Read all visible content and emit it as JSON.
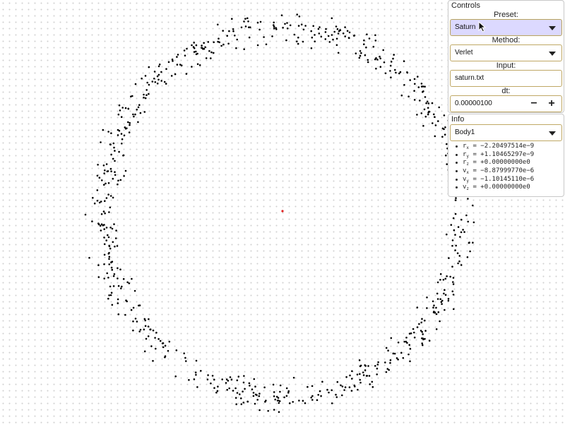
{
  "controls": {
    "title": "Controls",
    "preset_label": "Preset:",
    "preset_value": "Saturn",
    "method_label": "Method:",
    "method_value": "Verlet",
    "input_label": "Input:",
    "input_value": "saturn.txt",
    "dt_label": "dt:",
    "dt_value": "0.00000100",
    "dt_minus": "−",
    "dt_plus": "+"
  },
  "info": {
    "title": "Info",
    "body_value": "Body1",
    "lines": [
      {
        "name": "r",
        "sub": "x",
        "value": " = −2.20497514e−9"
      },
      {
        "name": "r",
        "sub": "y",
        "value": " = +1.10465297e−9"
      },
      {
        "name": "r",
        "sub": "z",
        "value": " = +0.00000000e0"
      },
      {
        "name": "v",
        "sub": "x",
        "value": " = −8.87999770e−6"
      },
      {
        "name": "v",
        "sub": "y",
        "value": " = −1.10145110e−6"
      },
      {
        "name": "v",
        "sub": "z",
        "value": " = +0.00000000e0"
      }
    ]
  },
  "simulation": {
    "center_color": "#e02020",
    "particle_color": "#000000",
    "ring_particle_count": 760
  },
  "icons": [
    "chevron-down-icon",
    "mouse-pointer-icon",
    "minus-icon",
    "plus-icon",
    "bullet-icon"
  ]
}
